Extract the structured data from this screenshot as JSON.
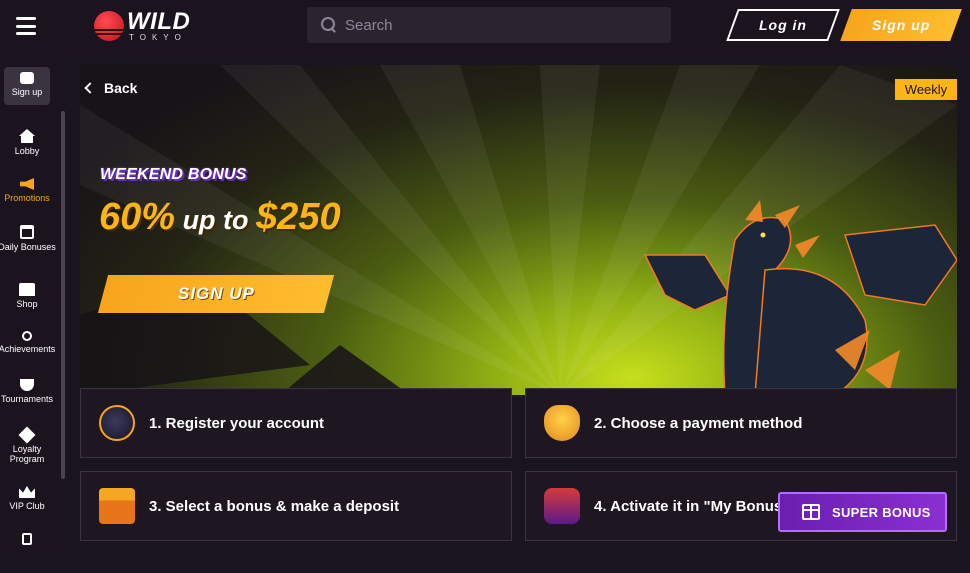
{
  "header": {
    "logo_main": "WILD",
    "logo_sub": "TOKYO",
    "search_placeholder": "Search",
    "login_label": "Log in",
    "signup_label": "Sign up"
  },
  "sidebar": {
    "items": [
      {
        "label": "Sign up",
        "icon": "signup-icon"
      },
      {
        "label": "Lobby",
        "icon": "home-icon"
      },
      {
        "label": "Promotions",
        "icon": "megaphone-icon"
      },
      {
        "label": "Daily Bonuses",
        "icon": "calendar-icon"
      },
      {
        "label": "Shop",
        "icon": "shop-icon"
      },
      {
        "label": "Achievements",
        "icon": "medal-icon"
      },
      {
        "label": "Tournaments",
        "icon": "trophy-icon"
      },
      {
        "label": "Loyalty Program",
        "icon": "diamond-icon"
      },
      {
        "label": "VIP Club",
        "icon": "crown-icon"
      }
    ]
  },
  "promo": {
    "back_label": "Back",
    "badge": "Weekly",
    "subtitle": "WEEKEND BONUS",
    "title_left": "60%",
    "title_mid": " up to ",
    "title_right": "$250",
    "cta": "SIGN UP"
  },
  "steps": [
    {
      "label": "1. Register your account",
      "icon": "account-icon"
    },
    {
      "label": "2. Choose a payment method",
      "icon": "money-bag-icon"
    },
    {
      "label": "3. Select a bonus & make a deposit",
      "icon": "gift-box-icon"
    },
    {
      "label": "4. Activate it in \"My Bonuses\"",
      "icon": "slot-machine-icon"
    }
  ],
  "super_bonus": {
    "label": "SUPER BONUS"
  },
  "colors": {
    "accent": "#f7a51c",
    "purple": "#7a2bc4",
    "bg": "#1a1320"
  }
}
